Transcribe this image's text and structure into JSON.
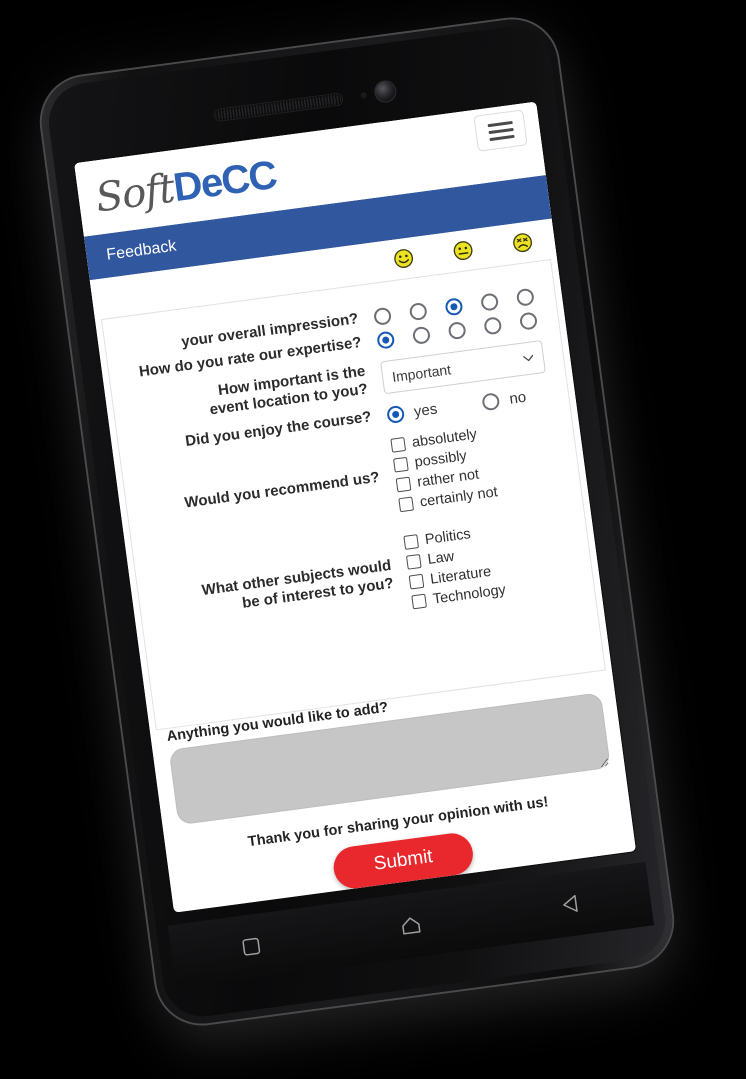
{
  "device": {
    "type": "android-phone",
    "earpiece": "earpiece-speaker",
    "camera": "front-camera",
    "nav": {
      "recents": "recents-square-icon",
      "home": "home-pentagon-icon",
      "back": "back-triangle-icon"
    }
  },
  "colors": {
    "header_blue": "#31579f",
    "brand_blue": "#2f62b3",
    "brand_gray": "#58585a",
    "submit_red": "#e8282d",
    "radio_selected": "#1559b5",
    "textarea_gray": "#c6c6c6",
    "background": "#000000"
  },
  "brand": {
    "part1": "Soft",
    "part2": "DeCC",
    "menu_icon": "hamburger-menu-icon"
  },
  "header": {
    "title": "Feedback"
  },
  "rating_legend": [
    {
      "name": "smiley-happy-icon",
      "mood": "happy"
    },
    {
      "name": "smiley-neutral-icon",
      "mood": "neutral"
    },
    {
      "name": "smiley-sad-icon",
      "mood": "sad"
    }
  ],
  "form": {
    "questions": [
      {
        "id": "overall-impression",
        "label": "your overall impression?",
        "type": "radio-scale",
        "options": 5,
        "selected_index": 2
      },
      {
        "id": "rate-expertise",
        "label": "How do you rate our expertise?",
        "type": "radio-scale",
        "options": 5,
        "selected_index": 0
      },
      {
        "id": "event-location-importance",
        "label": "How important is the\nevent location to you?",
        "label_line1": "How important is the",
        "label_line2": "event location to you?",
        "type": "select",
        "value": "Important",
        "chevron": "chevron-down-icon"
      },
      {
        "id": "enjoy-course",
        "label": "Did you enjoy the course?",
        "type": "radio-yesno",
        "options": [
          {
            "label": "yes",
            "checked": true
          },
          {
            "label": "no",
            "checked": false
          }
        ]
      },
      {
        "id": "recommend-us",
        "label": "Would you recommend us?",
        "type": "checkbox-group",
        "options": [
          {
            "label": "absolutely",
            "checked": false
          },
          {
            "label": "possibly",
            "checked": false
          },
          {
            "label": "rather not",
            "checked": false
          },
          {
            "label": "certainly not",
            "checked": false
          }
        ]
      },
      {
        "id": "other-subjects",
        "label": "What other subjects would\nbe of interest to you?",
        "label_line1": "What other subjects would",
        "label_line2": "be of interest to you?",
        "type": "checkbox-group",
        "options": [
          {
            "label": "Politics",
            "checked": false
          },
          {
            "label": "Law",
            "checked": false
          },
          {
            "label": "Literature",
            "checked": false
          },
          {
            "label": "Technology",
            "checked": false
          }
        ]
      }
    ],
    "comment": {
      "label": "Anything you would like to add?",
      "value": "",
      "placeholder": ""
    },
    "thanks": "Thank you for sharing your opinion with us!",
    "submit_label": "Submit"
  }
}
